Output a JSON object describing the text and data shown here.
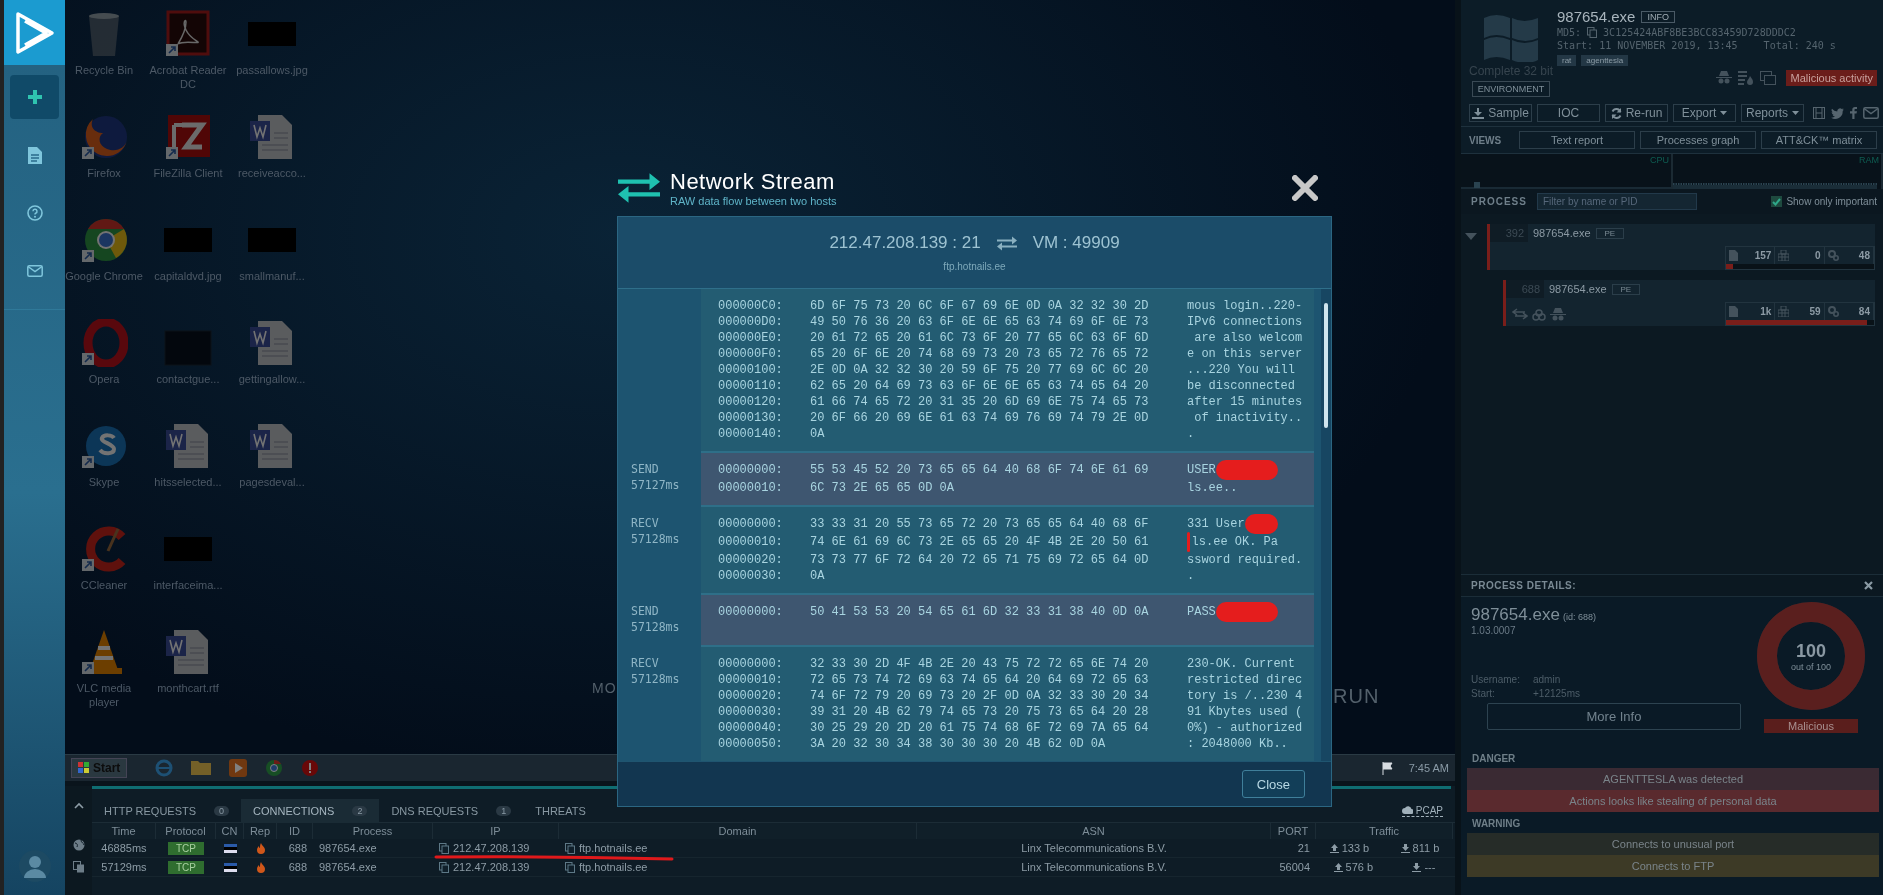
{
  "sidebar": {
    "items": [
      {
        "kind": "add",
        "selected": true
      },
      {
        "kind": "report",
        "selected": false
      },
      {
        "kind": "help",
        "selected": false
      },
      {
        "kind": "mail",
        "selected": false
      }
    ]
  },
  "desktop": {
    "columns": [
      [
        {
          "label": "Recycle Bin",
          "kind": "recycle-bin"
        },
        {
          "label": "Firefox",
          "kind": "firefox"
        },
        {
          "label": "Google Chrome",
          "kind": "chrome"
        },
        {
          "label": "Opera",
          "kind": "opera"
        },
        {
          "label": "Skype",
          "kind": "skype"
        },
        {
          "label": "CCleaner",
          "kind": "ccleaner"
        },
        {
          "label": "VLC media player",
          "kind": "vlc"
        }
      ],
      [
        {
          "label": "Acrobat Reader DC",
          "kind": "pdf"
        },
        {
          "label": "FileZilla Client",
          "kind": "filezilla"
        },
        {
          "label": "capitaldvd.jpg",
          "kind": "image"
        },
        {
          "label": "contactgue...",
          "kind": "blank"
        },
        {
          "label": "hitsselected...",
          "kind": "word"
        },
        {
          "label": "interfaceima...",
          "kind": "image"
        },
        {
          "label": "monthcart.rtf",
          "kind": "word"
        }
      ],
      [
        {
          "label": "passallows.jpg",
          "kind": "image"
        },
        {
          "label": "receiveacco...",
          "kind": "word"
        },
        {
          "label": "smallmanuf...",
          "kind": "image"
        },
        {
          "label": "gettingallow...",
          "kind": "word"
        },
        {
          "label": "pagesdeval...",
          "kind": "word"
        }
      ]
    ],
    "wallpaper_texts": [
      "MO",
      "RUN"
    ],
    "taskbar": {
      "start": "Start",
      "apps": [
        {
          "kind": "ie"
        },
        {
          "kind": "folder"
        },
        {
          "kind": "media"
        },
        {
          "kind": "chrome"
        },
        {
          "kind": "alert"
        }
      ],
      "time": "7:45 AM"
    }
  },
  "bottom": {
    "tabs": [
      {
        "label": "HTTP REQUESTS",
        "count": "0",
        "selected": false
      },
      {
        "label": "CONNECTIONS",
        "count": "2",
        "selected": true
      },
      {
        "label": "DNS REQUESTS",
        "count": "1",
        "selected": false
      },
      {
        "label": "THREATS",
        "selected": false
      }
    ],
    "pcap": "PCAP",
    "columns": [
      "Time",
      "Protocol",
      "CN",
      "Rep",
      "ID",
      "Process",
      "IP",
      "Domain",
      "ASN",
      "PORT",
      "Traffic"
    ],
    "rows": [
      {
        "time": "46885ms",
        "protocol": "TCP",
        "id": "688",
        "process": "987654.exe",
        "ip": "212.47.208.139",
        "domain": "ftp.hotnails.ee",
        "asn": "Linx Telecommunications B.V.",
        "port": "21",
        "sent": "133 b",
        "received": "811 b",
        "underlined": true
      },
      {
        "time": "57129ms",
        "protocol": "TCP",
        "id": "688",
        "process": "987654.exe",
        "ip": "212.47.208.139",
        "domain": "ftp.hotnails.ee",
        "asn": "Linx Telecommunications B.V.",
        "port": "56004",
        "sent": "576 b",
        "received": "---",
        "underlined": false
      }
    ]
  },
  "modal": {
    "title": "Network Stream",
    "subtitle": "RAW data flow between two hosts",
    "source": "212.47.208.139 : 21",
    "target": "VM : 49909",
    "host": "ftp.hotnails.ee",
    "close_button": "Close",
    "packets": [
      {
        "kind": "recv",
        "lines": [
          {
            "offset": "000000C0:",
            "hex": "6D 6F 75 73 20 6C 6F 67 69 6E 0D 0A 32 32 30 2D",
            "ascii": "mous login..220-"
          },
          {
            "offset": "000000D0:",
            "hex": "49 50 76 36 20 63 6F 6E 6E 65 63 74 69 6F 6E 73",
            "ascii": "IPv6 connections"
          },
          {
            "offset": "000000E0:",
            "hex": "20 61 72 65 20 61 6C 73 6F 20 77 65 6C 63 6F 6D",
            "ascii": " are also welcom"
          },
          {
            "offset": "000000F0:",
            "hex": "65 20 6F 6E 20 74 68 69 73 20 73 65 72 76 65 72",
            "ascii": "e on this server"
          },
          {
            "offset": "00000100:",
            "hex": "2E 0D 0A 32 32 30 20 59 6F 75 20 77 69 6C 6C 20",
            "ascii": "...220 You will"
          },
          {
            "offset": "00000110:",
            "hex": "62 65 20 64 69 73 63 6F 6E 6E 65 63 74 65 64 20",
            "ascii": "be disconnected"
          },
          {
            "offset": "00000120:",
            "hex": "61 66 74 65 72 20 31 35 20 6D 69 6E 75 74 65 73",
            "ascii": "after 15 minutes"
          },
          {
            "offset": "00000130:",
            "hex": "20 6F 66 20 69 6E 61 63 74 69 76 69 74 79 2E 0D",
            "ascii": " of inactivity.."
          },
          {
            "offset": "00000140:",
            "hex": "0A",
            "ascii": "."
          }
        ]
      },
      {
        "kind": "send",
        "direction": "SEND",
        "time": "57127ms",
        "lines": [
          {
            "offset": "00000000:",
            "hex": "55 53 45 52 20 73 65 65 64 40 68 6F 74 6E 61 69",
            "ascii": "USER",
            "kind": "redacted-end"
          },
          {
            "offset": "00000010:",
            "hex": "6C 73 2E 65 65 0D 0A",
            "ascii": "ls.ee.."
          }
        ]
      },
      {
        "kind": "recv",
        "direction": "RECV",
        "time": "57128ms",
        "lines": [
          {
            "offset": "00000000:",
            "hex": "33 33 31 20 55 73 65 72 20 73 65 65 64 40 68 6F",
            "ascii": "331 User",
            "kind": "redacted-end"
          },
          {
            "offset": "00000010:",
            "hex": "74 6E 61 69 6C 73 2E 65 65 20 4F 4B 2E 20 50 61",
            "ascii": "ls.ee OK. Pa",
            "kind": "redacted-start"
          },
          {
            "offset": "00000020:",
            "hex": "73 73 77 6F 72 64 20 72 65 71 75 69 72 65 64 0D",
            "ascii": "ssword required."
          },
          {
            "offset": "00000030:",
            "hex": "0A",
            "ascii": "."
          }
        ]
      },
      {
        "kind": "send",
        "direction": "SEND",
        "time": "57128ms",
        "lines": [
          {
            "offset": "00000000:",
            "hex": "50 41 53 53 20 54 65 61 6D 32 33 31 38 40 0D 0A",
            "ascii": "PASS",
            "kind": "redacted-end"
          }
        ]
      },
      {
        "kind": "recv",
        "direction": "RECV",
        "time": "57128ms",
        "lines": [
          {
            "offset": "00000000:",
            "hex": "32 33 30 2D 4F 4B 2E 20 43 75 72 72 65 6E 74 20",
            "ascii": "230-OK. Current"
          },
          {
            "offset": "00000010:",
            "hex": "72 65 73 74 72 69 63 74 65 64 20 64 69 72 65 63",
            "ascii": "restricted direc"
          },
          {
            "offset": "00000020:",
            "hex": "74 6F 72 79 20 69 73 20 2F 0D 0A 32 33 30 20 34",
            "ascii": "tory is /..230 4"
          },
          {
            "offset": "00000030:",
            "hex": "39 31 20 4B 62 79 74 65 73 20 75 73 65 64 20 28",
            "ascii": "91 Kbytes used ("
          },
          {
            "offset": "00000040:",
            "hex": "30 25 29 20 2D 20 61 75 74 68 6F 72 69 7A 65 64",
            "ascii": "0%) - authorized"
          },
          {
            "offset": "00000050:",
            "hex": "3A 20 32 30 34 38 30 30 30 20 4B 62 0D 0A",
            "ascii": ": 2048000 Kb.."
          }
        ]
      }
    ]
  },
  "report": {
    "os_label": "Complete 32 bit",
    "environment_button": "ENVIRONMENT",
    "file_name": "987654.exe",
    "info_badge": "INFO",
    "md5_label": "MD5:",
    "md5": "3C125424ABF8BE3BCC83459D728DDDC2",
    "start_label": "Start:",
    "start": "11 NOVEMBER 2019, 13:45",
    "total_label": "Total:",
    "total": "240 s",
    "tags": [
      "rat",
      "agenttesla"
    ],
    "indicators": [
      {
        "kind": "spy"
      },
      {
        "kind": "list-fire"
      },
      {
        "kind": "windows"
      }
    ],
    "verdict": "Malicious activity",
    "actions": [
      {
        "label": "Sample",
        "kind": "download"
      },
      {
        "label": "IOC",
        "kind": "plain"
      },
      {
        "label": "Re-run",
        "kind": "refresh"
      },
      {
        "label": "Export",
        "kind": "dropdown"
      },
      {
        "label": "Reports",
        "kind": "dropdown"
      }
    ],
    "share": [
      {
        "kind": "film"
      },
      {
        "kind": "twitter"
      },
      {
        "kind": "facebook"
      },
      {
        "kind": "mail"
      }
    ],
    "views_label": "VIEWS",
    "views": [
      "Text report",
      "Processes graph",
      "ATT&CK™ matrix"
    ],
    "cpu_label": "CPU",
    "ram_label": "RAM",
    "process_label": "PROCESS",
    "filter_placeholder": "Filter by name or PID",
    "show_important": {
      "label": "Show only important",
      "checked": true
    },
    "processes": [
      {
        "pid": "392",
        "name": "987654.exe",
        "type": "PE",
        "expanded": true,
        "files": "157",
        "registry": "0",
        "modules": "48",
        "level": 0.05,
        "children": [
          {
            "pid": "688",
            "name": "987654.exe",
            "type": "PE",
            "indicators": [
              {
                "kind": "network"
              },
              {
                "kind": "biohazard"
              },
              {
                "kind": "spy"
              }
            ],
            "files": "1k",
            "registry": "59",
            "modules": "84",
            "level": 0.95
          }
        ]
      }
    ],
    "details": {
      "header": "PROCESS DETAILS:",
      "name": "987654.exe",
      "id": "(id: 688)",
      "version": "1.03.0007",
      "fields": [
        {
          "label": "Username:",
          "value": "admin"
        },
        {
          "label": "Start:",
          "value": "+12125ms"
        }
      ],
      "more_info": "More Info",
      "score": "100",
      "score_caption": "out of 100",
      "level": 1,
      "verdict": "Malicious",
      "groups": [
        {
          "title": "DANGER",
          "items": [
            {
              "text": "AGENTTESLA was detected",
              "color": "#3a2a33"
            },
            {
              "text": "Actions looks like stealing of personal data",
              "color": "#5a2a2e"
            }
          ]
        },
        {
          "title": "WARNING",
          "items": [
            {
              "text": "Connects to unusual port",
              "color": "#262c28"
            },
            {
              "text": "Connects to FTP",
              "color": "#3d3a26"
            }
          ]
        }
      ]
    }
  }
}
